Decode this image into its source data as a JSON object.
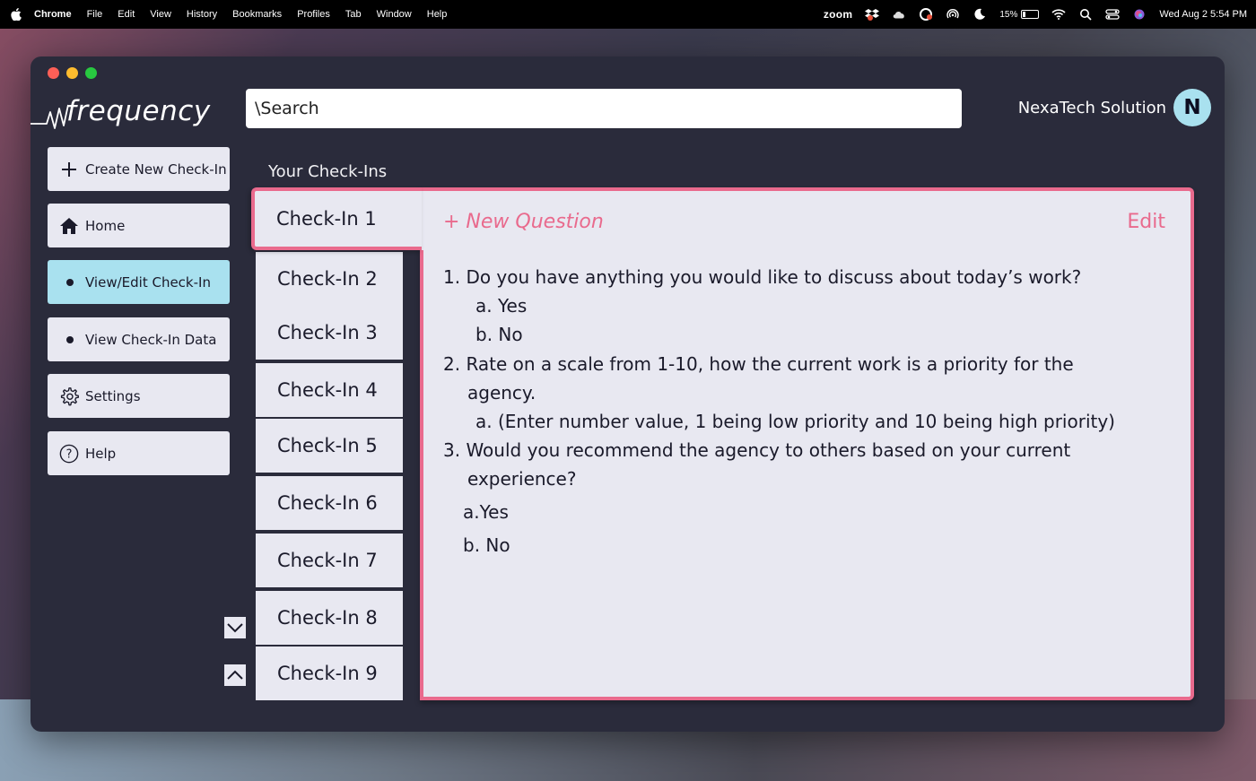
{
  "menubar": {
    "app": "Chrome",
    "items": [
      "File",
      "Edit",
      "View",
      "History",
      "Bookmarks",
      "Profiles",
      "Tab",
      "Window",
      "Help"
    ],
    "zoom": "zoom",
    "battery": "15%",
    "datetime": "Wed Aug 2  5:54 PM"
  },
  "app": {
    "logo": "frequency",
    "search_value": "\\Search",
    "org_name": "NexaTech Solution",
    "avatar_letter": "N"
  },
  "sidebar": {
    "items": [
      {
        "label": "Create New Check-In",
        "icon": "plus-icon"
      },
      {
        "label": "Home",
        "icon": "home-icon"
      },
      {
        "label": "View/Edit Check-In",
        "icon": "bullet-icon",
        "active": true
      },
      {
        "label": "View Check-In Data",
        "icon": "bullet-icon"
      },
      {
        "label": "Settings",
        "icon": "gear-icon"
      },
      {
        "label": "Help",
        "icon": "help-icon"
      }
    ]
  },
  "checkins": {
    "title": "Your Check-Ins",
    "items": [
      "Check-In 1",
      "Check-In 2",
      "Check-In 3",
      "Check-In 4",
      "Check-In 5",
      "Check-In 6",
      "Check-In 7",
      "Check-In 8",
      "Check-In 9"
    ]
  },
  "panel": {
    "new_question": "+ New Question",
    "edit": "Edit",
    "lines": [
      "1. Do you have anything you would like to discuss about today’s work?",
      "a. Yes",
      "b. No",
      "2. Rate on a scale from 1-10, how the current work is a priority for the",
      "agency.",
      "a. (Enter number value, 1 being low priority and 10 being high priority)",
      "3.  Would you recommend the agency to others based on your current",
      "experience?",
      "a.Yes",
      "b. No"
    ]
  },
  "colors": {
    "accent_pink": "#e96a8d",
    "active_blue": "#a9e1ef",
    "window_bg": "#2a2b3b",
    "card_bg": "#e8e8f1"
  }
}
